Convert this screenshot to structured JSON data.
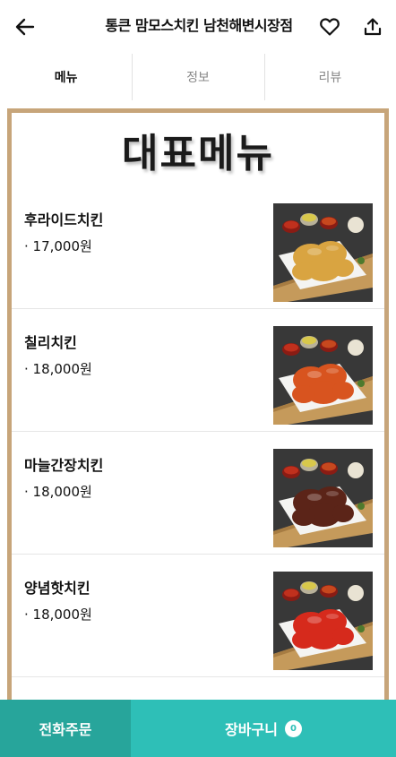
{
  "header": {
    "title": "통큰 맘모스치킨 남천해변시장점",
    "back_icon": "arrow-left-icon",
    "favorite_icon": "heart-icon",
    "share_icon": "share-icon"
  },
  "tabs": [
    {
      "label": "메뉴",
      "active": true
    },
    {
      "label": "정보",
      "active": false
    },
    {
      "label": "리뷰",
      "active": false
    }
  ],
  "menu_board": {
    "title": "대표메뉴",
    "items": [
      {
        "name": "후라이드치킨",
        "price": "· 17,000원",
        "sauce": "#d9a441"
      },
      {
        "name": "칠리치킨",
        "price": "· 18,000원",
        "sauce": "#d8541f"
      },
      {
        "name": "마늘간장치킨",
        "price": "· 18,000원",
        "sauce": "#5b2418"
      },
      {
        "name": "양념핫치킨",
        "price": "· 18,000원",
        "sauce": "#d62a1c"
      }
    ]
  },
  "bottom_bar": {
    "phone_order": "전화주문",
    "cart": "장바구니",
    "cart_count": "0"
  },
  "colors": {
    "board_border": "#c7a57a",
    "phone_button": "#27a59b",
    "cart_button": "#2ebfb7"
  }
}
